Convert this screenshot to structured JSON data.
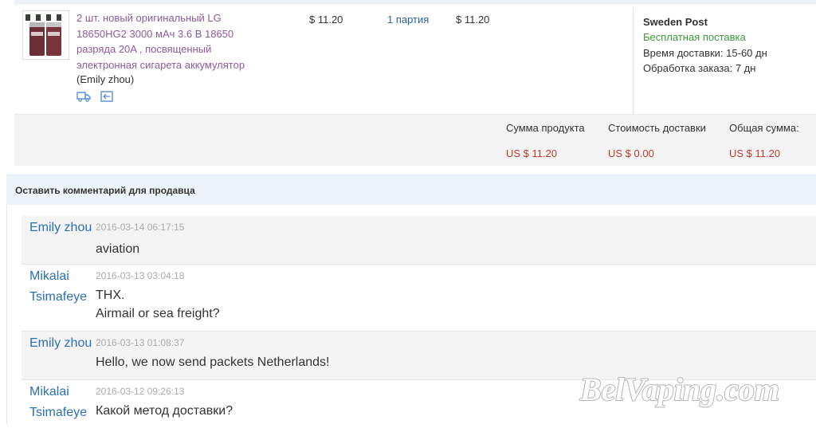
{
  "product": {
    "name": "2 шт. новый оригинальный LG 18650HG2 3000 мАч 3.6 В 18650 разряда 20A , посвященный электронная сигарета аккумулятор",
    "seller": "(Emily zhou)",
    "icons": [
      "truck-icon",
      "return-icon"
    ],
    "price": "$ 11.20",
    "quantity": "1 партия",
    "total": "$ 11.20"
  },
  "shipping": {
    "carrier": "Sweden Post",
    "free_label": "Бесплатная поставка",
    "delivery_time": "Время доставки: 15-60 дн",
    "processing_time": "Обработка заказа: 7 дн"
  },
  "summary": {
    "product_label": "Сумма продукта",
    "product_value": "US $ 11.20",
    "shipping_label": "Стоимость доставки",
    "shipping_value": "US $ 0.00",
    "total_label": "Общая сумма:",
    "total_value": "US $ 11.20"
  },
  "feedback": {
    "title": "Оставить комментарий для продавца",
    "messages": [
      {
        "author": "Emily zhou",
        "date": "2016-03-14 06:17:15",
        "text": "aviation"
      },
      {
        "author": "Mikalai Tsimafeye",
        "date": "2016-03-13 03:04:18",
        "text": "THX.\nAirmail or sea freight?"
      },
      {
        "author": "Emily zhou",
        "date": "2016-03-13 01:08:37",
        "text": "Hello, we now send packets Netherlands!"
      },
      {
        "author": "Mikalai Tsimafeye",
        "date": "2016-03-12 09:26:13",
        "text": "Какой метод доставки?"
      }
    ]
  },
  "watermark": "BelVaping.com"
}
